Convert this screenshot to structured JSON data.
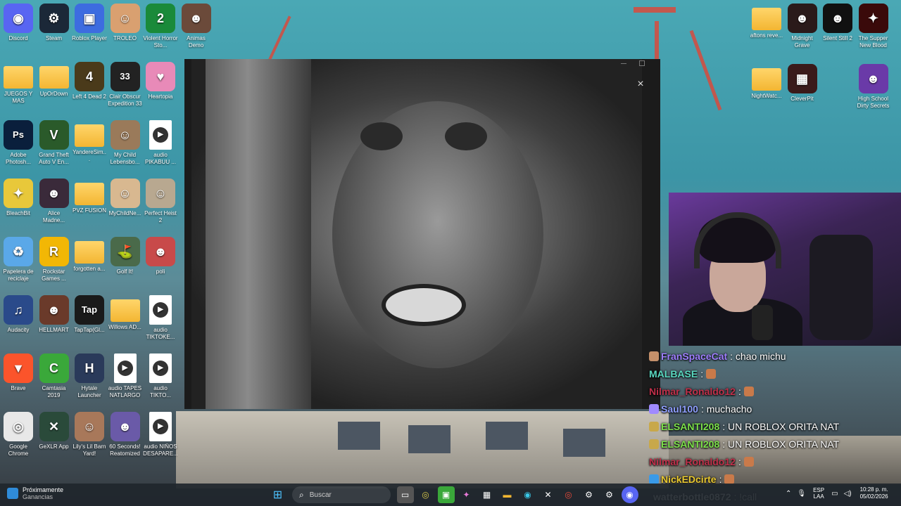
{
  "desktop": {
    "icons": [
      {
        "label": "Discord",
        "icon": "discord-icon",
        "color": "#5865f2",
        "glyph": "◉"
      },
      {
        "label": "Steam",
        "icon": "steam-icon",
        "color": "#1b2838",
        "glyph": "⚙"
      },
      {
        "label": "Roblox Player",
        "icon": "roblox-icon",
        "color": "#3d6ce0",
        "glyph": "▣"
      },
      {
        "label": "TROLEO",
        "icon": "troll-face-icon",
        "color": "#d9a070",
        "glyph": "☺"
      },
      {
        "label": "Violent Horror Sto...",
        "icon": "game-icon",
        "color": "#1a8a3a",
        "glyph": "2"
      },
      {
        "label": "Animas Demo",
        "icon": "game-icon",
        "color": "#6b4a3a",
        "glyph": "☻"
      },
      {
        "label": "JUEGOS Y MAS",
        "icon": "folder-icon",
        "type": "folder"
      },
      {
        "label": "UpOrDown",
        "icon": "folder-icon",
        "type": "folder"
      },
      {
        "label": "Left 4 Dead 2",
        "icon": "game-icon",
        "color": "#4a3a1a",
        "glyph": "4"
      },
      {
        "label": "Clair Obscur Expedition 33",
        "icon": "game-icon",
        "color": "#222",
        "glyph": "33"
      },
      {
        "label": "Heartopia",
        "icon": "game-icon",
        "color": "#e88ab8",
        "glyph": "♥"
      },
      {
        "label": "Adobe Photosh...",
        "icon": "photoshop-icon",
        "color": "#0a1f3c",
        "glyph": "Ps"
      },
      {
        "label": "Grand Theft Auto V En...",
        "icon": "gta-icon",
        "color": "#2a5a2a",
        "glyph": "V"
      },
      {
        "label": "YandereSim...",
        "icon": "folder-icon",
        "type": "folder"
      },
      {
        "label": "My Child Lebensbo...",
        "icon": "game-icon",
        "color": "#9a7a5a",
        "glyph": "☺"
      },
      {
        "label": "audio PIKABUU ...",
        "icon": "audio-file-icon",
        "type": "audio"
      },
      {
        "label": "BleachBit",
        "icon": "bleachbit-icon",
        "color": "#e8c83a",
        "glyph": "✦"
      },
      {
        "label": "Alice Madne...",
        "icon": "game-icon",
        "color": "#3a2a3a",
        "glyph": "☻"
      },
      {
        "label": "PVZ FUSION",
        "icon": "folder-icon",
        "type": "folder"
      },
      {
        "label": "MyChildNe...",
        "icon": "game-icon",
        "color": "#d8b890",
        "glyph": "☺"
      },
      {
        "label": "Perfect Heist 2",
        "icon": "game-icon",
        "color": "#b8a890",
        "glyph": "☺"
      },
      {
        "label": "Papelera de reciclaje",
        "icon": "recycle-bin-icon",
        "color": "#5aa8e8",
        "glyph": "♻"
      },
      {
        "label": "Rockstar Games ...",
        "icon": "rockstar-icon",
        "color": "#f2b705",
        "glyph": "R"
      },
      {
        "label": "forgotten a...",
        "icon": "folder-icon",
        "type": "folder"
      },
      {
        "label": "Golf It!",
        "icon": "game-icon",
        "color": "#4a6a4a",
        "glyph": "⛳"
      },
      {
        "label": "poli",
        "icon": "game-icon",
        "color": "#c84a4a",
        "glyph": "☻"
      },
      {
        "label": "Audacity",
        "icon": "audacity-icon",
        "color": "#2a4a8a",
        "glyph": "♫"
      },
      {
        "label": "HELLMART",
        "icon": "game-icon",
        "color": "#6a3a2a",
        "glyph": "☻"
      },
      {
        "label": "TapTap(Gl...",
        "icon": "taptap-icon",
        "color": "#1a1a1a",
        "glyph": "Tap"
      },
      {
        "label": "Willows AD...",
        "icon": "folder-icon",
        "type": "folder"
      },
      {
        "label": "audio TIKTOKE...",
        "icon": "audio-file-icon",
        "type": "audio"
      },
      {
        "label": "Brave",
        "icon": "brave-icon",
        "color": "#fb542b",
        "glyph": "▼"
      },
      {
        "label": "Camtasia 2019",
        "icon": "camtasia-icon",
        "color": "#3aa83a",
        "glyph": "C"
      },
      {
        "label": "Hytale Launcher",
        "icon": "hytale-icon",
        "color": "#2a3a5a",
        "glyph": "H"
      },
      {
        "label": "audio TAPES NATLARGO",
        "icon": "audio-file-icon",
        "type": "audio"
      },
      {
        "label": "audio TIKTO...",
        "icon": "audio-file-icon",
        "type": "audio"
      },
      {
        "label": "Google Chrome",
        "icon": "chrome-icon",
        "color": "#e8e8e8",
        "glyph": "◎"
      },
      {
        "label": "GeXLR App",
        "icon": "app-icon",
        "color": "#2a4a3a",
        "glyph": "✕"
      },
      {
        "label": "Lily's Lil Barn Yard!",
        "icon": "game-icon",
        "color": "#a8785a",
        "glyph": "☺"
      },
      {
        "label": "60 Seconds! Reatomized",
        "icon": "game-icon",
        "color": "#6a5aa8",
        "glyph": "☻"
      },
      {
        "label": "audio NIÑOS DESAPARE...",
        "icon": "audio-file-icon",
        "type": "audio"
      }
    ],
    "right_icons": [
      {
        "label": "aftons reve...",
        "icon": "folder-icon",
        "type": "folder"
      },
      {
        "label": "Midnight Grave",
        "icon": "game-icon",
        "color": "#2a1a1a",
        "glyph": "☻"
      },
      {
        "label": "Silent Still 2",
        "icon": "game-icon",
        "color": "#111",
        "glyph": "☻"
      },
      {
        "label": "The Supper New Blood",
        "icon": "game-icon",
        "color": "#3a0a0a",
        "glyph": "✦"
      },
      {
        "label": "NightWatc...",
        "icon": "folder-icon",
        "type": "folder"
      },
      {
        "label": "CleverPit",
        "icon": "game-icon",
        "color": "#3a1a1a",
        "glyph": "▦"
      },
      {
        "label": "High School Dirty Secrets",
        "icon": "game-icon",
        "color": "#6a3aa8",
        "glyph": "☻"
      }
    ]
  },
  "viewer": {
    "close_label": "×"
  },
  "chat": [
    {
      "user": "FranSpaceCat",
      "color": "#9f7fff",
      "message": ": chao michu",
      "badge": "#c4906a"
    },
    {
      "user": "MALBASE",
      "color": "#5ad8c0",
      "message": ":",
      "emote": true
    },
    {
      "user": "Nilmar_Ronaldo12",
      "color": "#c0304a",
      "message": ":",
      "emote": true
    },
    {
      "user": "Saul100",
      "color": "#8f9fff",
      "message": ": muchacho",
      "badge": "#a08aff"
    },
    {
      "user": "ELSANTI208",
      "color": "#7be04a",
      "message": ": UN ROBLOX ORITA NAT",
      "badge": "#c8a84a"
    },
    {
      "user": "ELSANTI208",
      "color": "#7be04a",
      "message": ": UN ROBLOX ORITA NAT",
      "badge": "#c8a84a"
    },
    {
      "user": "Nilmar_Ronaldo12",
      "color": "#c0304a",
      "message": ":",
      "emote": true
    },
    {
      "user": "NickEDcirte",
      "color": "#e8c830",
      "message": ":",
      "emote": true,
      "badge": "#3a9ae8"
    },
    {
      "user": "watterbottle0872",
      "color": "#ffffff",
      "message": ": !call"
    }
  ],
  "taskbar": {
    "news_title": "Próximamente",
    "news_subtitle": "Ganancias",
    "search_placeholder": "Buscar",
    "lang_top": "ESP",
    "lang_bottom": "LAA",
    "time": "10:28 p. m.",
    "date": "05/02/2026"
  }
}
